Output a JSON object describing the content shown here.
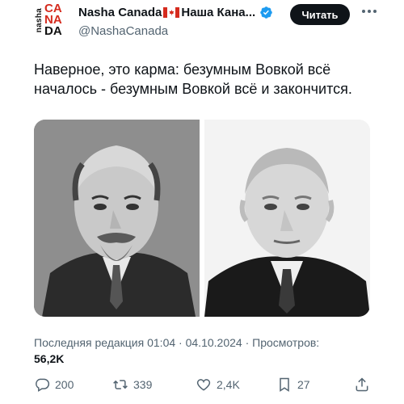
{
  "account": {
    "name": "Nasha Canada",
    "name_suffix": "Наша Кана...",
    "handle": "@NashaCanada",
    "avatar": {
      "vertical": "nasha",
      "lines": [
        "CA",
        "NA",
        "DA"
      ]
    },
    "follow_label": "Читать"
  },
  "tweet": {
    "text": "Наверное, это карма: безумным Вовкой всё началось - безумным Вовкой всё и закончится."
  },
  "meta": {
    "prefix": "Последняя редакция ",
    "time": "01:04",
    "sep1": " · ",
    "date": "04.10.2024",
    "sep2": " · Просмотров: ",
    "views": "56,2K"
  },
  "actions": {
    "replies": "200",
    "reposts": "339",
    "likes": "2,4K",
    "bookmarks": "27"
  },
  "colors": {
    "accent": "#1d9bf0",
    "text": "#0f1419",
    "muted": "#536471",
    "flag_red": "#d52b1e"
  }
}
